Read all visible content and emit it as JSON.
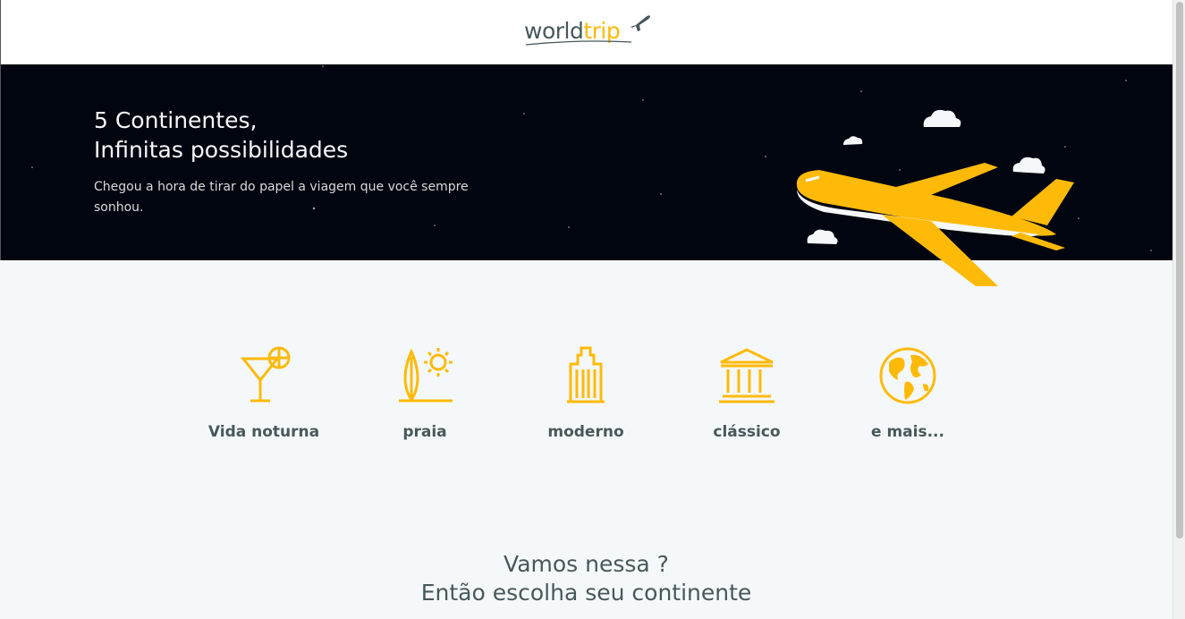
{
  "logo": {
    "word1": "world",
    "word2": "trip"
  },
  "banner": {
    "title_line1": "5 Continentes,",
    "title_line2": "Infinitas possibilidades",
    "subtitle": "Chegou a hora de tirar do papel a viagem que você sempre sonhou."
  },
  "travel_types": [
    {
      "label": "Vida noturna",
      "icon": "cocktail-icon"
    },
    {
      "label": "praia",
      "icon": "surfboard-icon"
    },
    {
      "label": "moderno",
      "icon": "building-icon"
    },
    {
      "label": "clássico",
      "icon": "museum-icon"
    },
    {
      "label": "e mais...",
      "icon": "earth-icon"
    }
  ],
  "cta": {
    "line1": "Vamos nessa ?",
    "line2": "Então escolha seu continente"
  },
  "colors": {
    "accent": "#ffba08",
    "dark_text": "#47585b",
    "banner_bg": "#000510",
    "page_bg": "#f5f8fa"
  }
}
